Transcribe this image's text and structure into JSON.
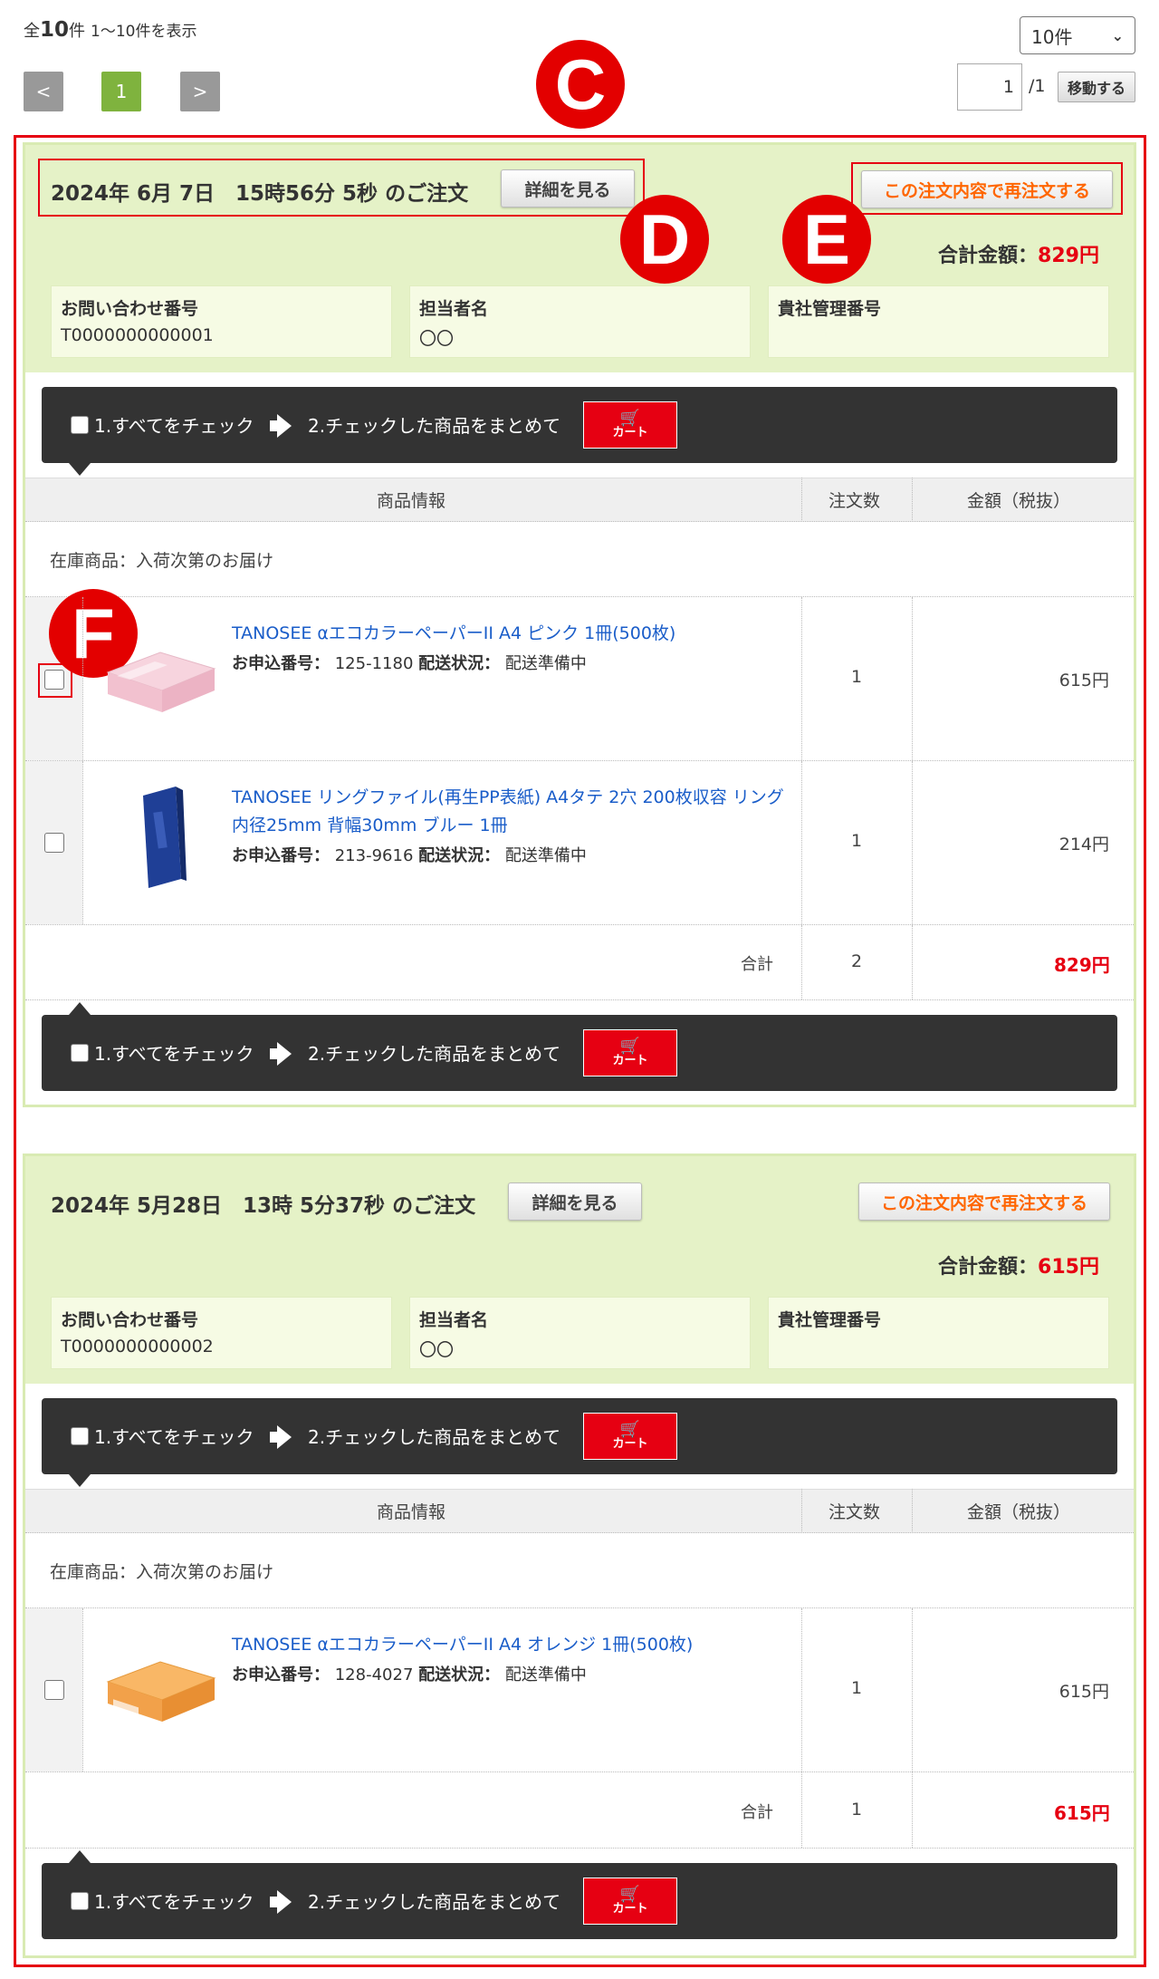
{
  "header": {
    "count_prefix": "全",
    "count_number": "10",
    "count_suffix": "件",
    "range_text": "1～10件を表示",
    "per_page_value": "10件"
  },
  "pager": {
    "prev": "<",
    "current": "1",
    "next": ">",
    "page_input_value": "1",
    "page_total": "/1",
    "move_label": "移動する"
  },
  "markers": {
    "c": "C",
    "d": "D",
    "e": "E",
    "f": "F"
  },
  "labels": {
    "detail_button": "詳細を見る",
    "reorder_button": "この注文内容で再注文する",
    "total_label": "合計金額：",
    "inquiry_label": "お問い合わせ番号",
    "staff_label": "担当者名",
    "mgmt_label": "貴社管理番号",
    "check_all": "1.すべてをチェック",
    "bulk_text": "2.チェックした商品をまとめて",
    "cart_label": "カート",
    "col_product": "商品情報",
    "col_qty": "注文数",
    "col_price": "金額（税抜）",
    "stock_note": "在庫商品：入荷次第のお届け",
    "app_no_label": "お申込番号：",
    "ship_label": "配送状況：",
    "sum_label": "合計"
  },
  "orders": [
    {
      "title": "2024年 6月 7日　15時56分 5秒 のご注文",
      "total": "829円",
      "inquiry_no": "T0000000000001",
      "staff": "〇〇",
      "mgmt_no": "",
      "items": [
        {
          "name": "TANOSEE αエコカラーペーパーII A4 ピンク 1冊(500枚)",
          "app_no": "125-1180",
          "ship_status": "配送準備中",
          "qty": "1",
          "price": "615円",
          "image": "pink-paper-ream",
          "image_color": "#f4c6d2"
        },
        {
          "name": "TANOSEE リングファイル(再生PP表紙) A4タテ 2穴 200枚収容 リング内径25mm 背幅30mm ブルー 1冊",
          "app_no": "213-9616",
          "ship_status": "配送準備中",
          "qty": "1",
          "price": "214円",
          "image": "blue-ring-binder",
          "image_color": "#1f3f96"
        }
      ],
      "sum_qty": "2",
      "sum_price": "829円"
    },
    {
      "title": "2024年 5月28日　13時 5分37秒 のご注文",
      "total": "615円",
      "inquiry_no": "T0000000000002",
      "staff": "〇〇",
      "mgmt_no": "",
      "items": [
        {
          "name": "TANOSEE αエコカラーペーパーII A4 オレンジ 1冊(500枚)",
          "app_no": "128-4027",
          "ship_status": "配送準備中",
          "qty": "1",
          "price": "615円",
          "image": "orange-paper-ream",
          "image_color": "#f7a24a"
        }
      ],
      "sum_qty": "1",
      "sum_price": "615円"
    }
  ],
  "colors": {
    "accent_red": "#e60012",
    "card_green": "#e5f2c7",
    "link_blue": "#1a5dc9",
    "page_current": "#7fb33e"
  }
}
